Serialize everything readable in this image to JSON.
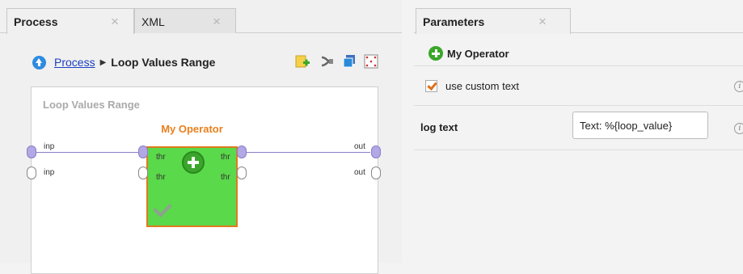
{
  "left_tabs": [
    {
      "label": "Process",
      "close": "×",
      "active": true
    },
    {
      "label": "XML",
      "close": "×",
      "active": false
    }
  ],
  "breadcrumb": {
    "root": "Process",
    "separator": "▶",
    "current": "Loop Values Range"
  },
  "toolbar_icons": [
    "add-building-block-icon",
    "auto-wire-icon",
    "layers-icon",
    "fit-view-icon"
  ],
  "canvas": {
    "title": "Loop Values Range",
    "left_ports": [
      "inp",
      "inp"
    ],
    "right_ports": [
      "out",
      "out"
    ]
  },
  "operator": {
    "name": "My Operator",
    "input_ports": [
      "thr",
      "thr"
    ],
    "output_ports": [
      "thr",
      "thr"
    ],
    "icon": "plus-circle-icon",
    "status_icon": "checkmark-icon",
    "colors": {
      "fill": "#5ad94a",
      "border": "#e07a1e",
      "title": "#e8801e"
    }
  },
  "right_tabs": [
    {
      "label": "Parameters",
      "close": "×",
      "active": true
    }
  ],
  "parameters": {
    "operator_name": "My Operator",
    "rows": [
      {
        "type": "checkbox",
        "label": "use custom text",
        "checked": true
      },
      {
        "type": "text",
        "label": "log text",
        "value": "Text: %{loop_value}"
      }
    ],
    "info_glyph": "i"
  }
}
